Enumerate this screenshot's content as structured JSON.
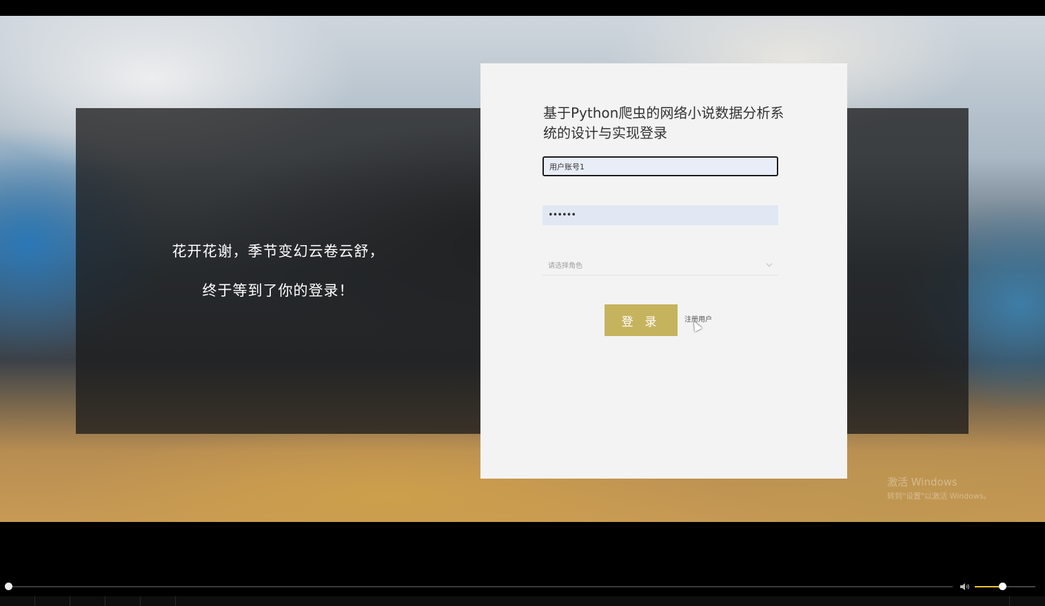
{
  "slogan": {
    "line1": "花开花谢，季节变幻云卷云舒，",
    "line2": "终于等到了你的登录！"
  },
  "login": {
    "title": "基于Python爬虫的网络小说数据分析系统的设计与实现登录",
    "account_value": "用户账号1",
    "password_value": "••••••",
    "role_placeholder": "请选择角色",
    "login_label": "登 录",
    "register_label": "注册用户",
    "button_color": "#c6b35e"
  },
  "watermark": {
    "line1": "激活 Windows",
    "line2": "转到\"设置\"以激活 Windows。"
  },
  "player": {
    "progress": 0.0,
    "volume": 0.45,
    "accent_color": "#f0c43a"
  }
}
